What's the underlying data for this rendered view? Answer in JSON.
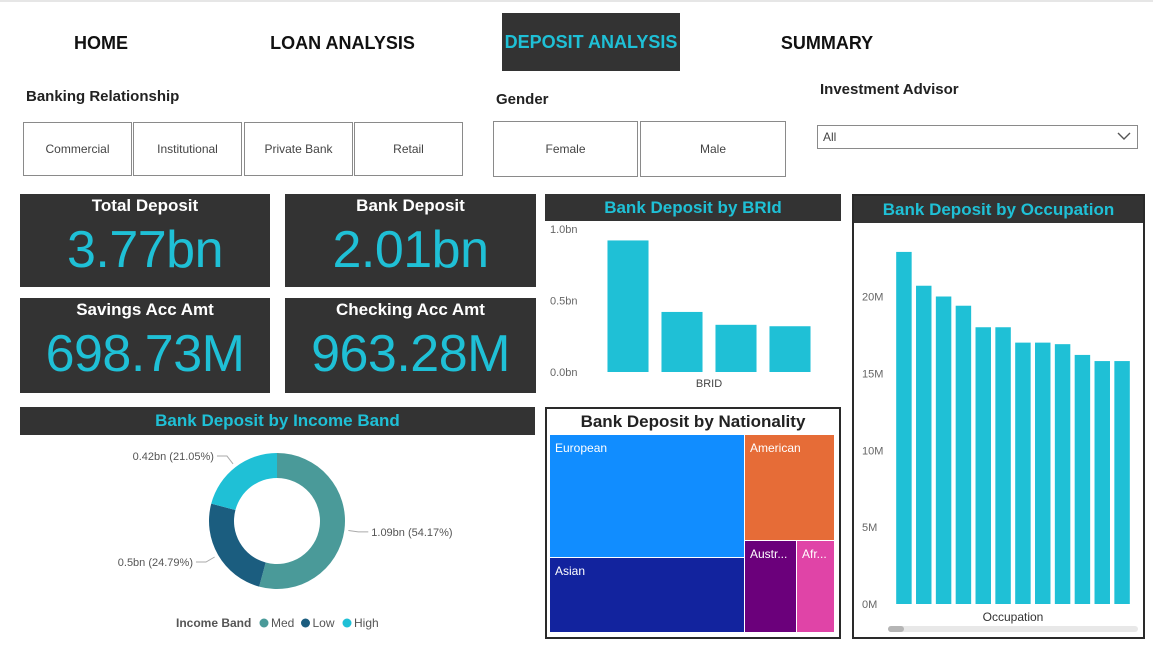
{
  "nav": {
    "home": "HOME",
    "loan": "LOAN ANALYSIS",
    "deposit": "DEPOSIT ANALYSIS",
    "summary": "SUMMARY"
  },
  "filters": {
    "banking_relationship": {
      "title": "Banking Relationship",
      "options": [
        "Commercial",
        "Institutional",
        "Private Bank",
        "Retail"
      ]
    },
    "gender": {
      "title": "Gender",
      "options": [
        "Female",
        "Male"
      ]
    },
    "investment_advisor": {
      "title": "Investment Advisor",
      "selected": "All"
    }
  },
  "kpis": {
    "total_deposit": {
      "label": "Total Deposit",
      "value": "3.77bn"
    },
    "bank_deposit": {
      "label": "Bank Deposit",
      "value": "2.01bn"
    },
    "savings": {
      "label": "Savings Acc Amt",
      "value": "698.73M"
    },
    "checking": {
      "label": "Checking Acc Amt",
      "value": "963.28M"
    }
  },
  "colors": {
    "accent": "#1fc0d6",
    "dark_panel": "#333333",
    "teal": "#4a9a99",
    "navy": "#1b5d7f",
    "european": "#118dff",
    "asian": "#12239e",
    "american": "#e66c37",
    "australian": "#6b007b",
    "african": "#e044a7"
  },
  "chart_data": [
    {
      "id": "brid",
      "type": "bar",
      "title": "Bank Deposit by BRId",
      "xlabel": "BRID",
      "ylabel": "",
      "yticks": [
        "0.0bn",
        "0.5bn",
        "1.0bn"
      ],
      "ylim": [
        0,
        1.0
      ],
      "values": [
        0.92,
        0.42,
        0.33,
        0.32
      ]
    },
    {
      "id": "occupation",
      "type": "bar",
      "title": "Bank Deposit by Occupation",
      "xlabel": "Occupation",
      "ylabel": "",
      "yticks": [
        "0M",
        "5M",
        "10M",
        "15M",
        "20M"
      ],
      "ylim": [
        0,
        24
      ],
      "values": [
        22.9,
        20.7,
        20.0,
        19.4,
        18.0,
        18.0,
        17.0,
        17.0,
        16.9,
        16.2,
        15.8,
        15.8
      ]
    },
    {
      "id": "income",
      "type": "pie",
      "title": "Bank Deposit by Income Band",
      "legend_title": "Income Band",
      "slices": [
        {
          "name": "Med",
          "value": 1.09,
          "label": "1.09bn (54.17%)"
        },
        {
          "name": "Low",
          "value": 0.5,
          "label": "0.5bn (24.79%)"
        },
        {
          "name": "High",
          "value": 0.42,
          "label": "0.42bn (21.05%)"
        }
      ]
    },
    {
      "id": "nationality",
      "type": "treemap",
      "title": "Bank Deposit by Nationality",
      "items": [
        {
          "name": "European",
          "label": "European"
        },
        {
          "name": "Asian",
          "label": "Asian"
        },
        {
          "name": "American",
          "label": "American"
        },
        {
          "name": "Australian",
          "label": "Austr..."
        },
        {
          "name": "African",
          "label": "Afr..."
        }
      ]
    }
  ]
}
